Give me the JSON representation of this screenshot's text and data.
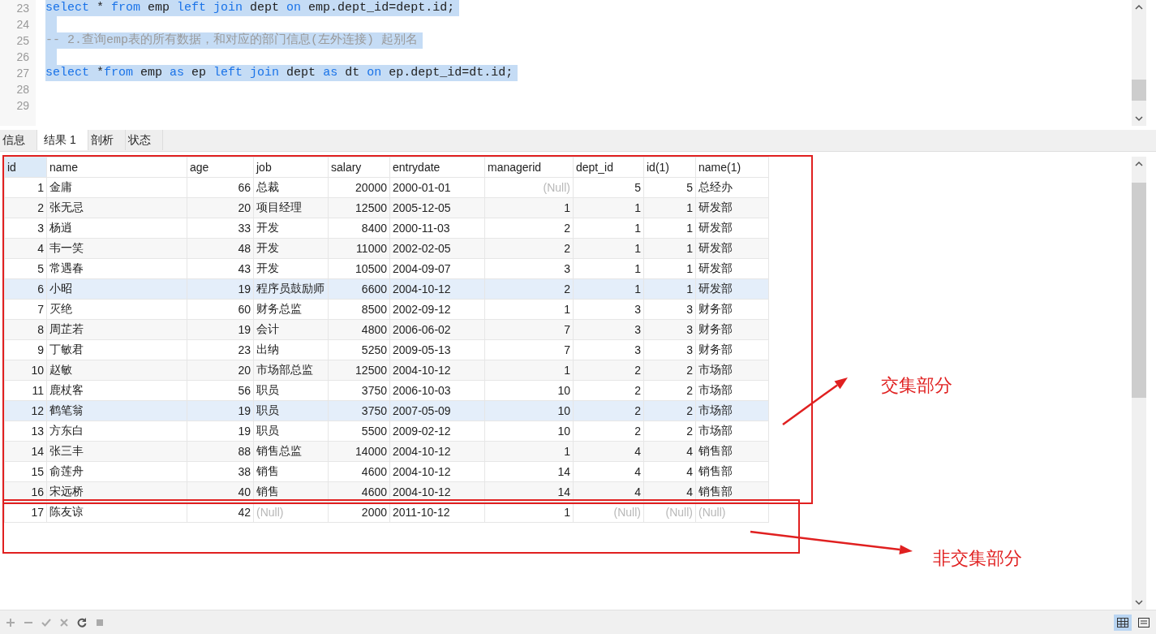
{
  "editor": {
    "lines": [
      {
        "number": "23",
        "selected": true,
        "tokens": [
          {
            "text": "select",
            "kind": "keyword"
          },
          {
            "text": " * ",
            "kind": "plain"
          },
          {
            "text": "from",
            "kind": "keyword"
          },
          {
            "text": " emp ",
            "kind": "plain"
          },
          {
            "text": "left join",
            "kind": "keyword"
          },
          {
            "text": " dept ",
            "kind": "plain"
          },
          {
            "text": "on",
            "kind": "keyword"
          },
          {
            "text": " emp.dept_id=dept.id;",
            "kind": "plain"
          }
        ]
      },
      {
        "number": "24",
        "selected": true
      },
      {
        "number": "25",
        "selected": true,
        "tokens": [
          {
            "text": "-- 2.查询emp表的所有数据，和对应的部门信息(左外连接) 起别名",
            "kind": "comment"
          }
        ]
      },
      {
        "number": "26",
        "selected": true
      },
      {
        "number": "27",
        "selected": true,
        "tokens": [
          {
            "text": "select",
            "kind": "keyword"
          },
          {
            "text": " *",
            "kind": "plain"
          },
          {
            "text": "from",
            "kind": "keyword"
          },
          {
            "text": " emp ",
            "kind": "plain"
          },
          {
            "text": "as",
            "kind": "keyword"
          },
          {
            "text": " ep ",
            "kind": "plain"
          },
          {
            "text": "left join",
            "kind": "keyword"
          },
          {
            "text": " dept ",
            "kind": "plain"
          },
          {
            "text": "as",
            "kind": "keyword"
          },
          {
            "text": " dt ",
            "kind": "plain"
          },
          {
            "text": "on",
            "kind": "keyword"
          },
          {
            "text": " ep.dept_id=dt.id;",
            "kind": "plain"
          }
        ]
      },
      {
        "number": "28",
        "selected": false
      },
      {
        "number": "29",
        "selected": false
      }
    ]
  },
  "tabs": [
    {
      "label": "信息",
      "selected": false
    },
    {
      "label": "结果 1",
      "selected": true
    },
    {
      "label": "剖析",
      "selected": false
    },
    {
      "label": "状态",
      "selected": false
    }
  ],
  "table": {
    "columns": [
      {
        "label": "id",
        "kind": "number"
      },
      {
        "label": "name",
        "kind": "text"
      },
      {
        "label": "age",
        "kind": "number"
      },
      {
        "label": "job",
        "kind": "text"
      },
      {
        "label": "salary",
        "kind": "number"
      },
      {
        "label": "entrydate",
        "kind": "text"
      },
      {
        "label": "managerid",
        "kind": "number"
      },
      {
        "label": "dept_id",
        "kind": "number"
      },
      {
        "label": "id(1)",
        "kind": "number"
      },
      {
        "label": "name(1)",
        "kind": "text"
      }
    ],
    "rows": [
      {
        "highlighted": false,
        "cells": [
          "1",
          "金庸",
          "66",
          "总裁",
          "20000",
          "2000-01-01",
          {
            "text": "(Null)",
            "null": true
          },
          "5",
          "5",
          "总经办"
        ]
      },
      {
        "highlighted": false,
        "cells": [
          "2",
          "张无忌",
          "20",
          "项目经理",
          "12500",
          "2005-12-05",
          "1",
          "1",
          "1",
          "研发部"
        ]
      },
      {
        "highlighted": false,
        "cells": [
          "3",
          "杨逍",
          "33",
          "开发",
          "8400",
          "2000-11-03",
          "2",
          "1",
          "1",
          "研发部"
        ]
      },
      {
        "highlighted": false,
        "cells": [
          "4",
          "韦一笑",
          "48",
          "开发",
          "11000",
          "2002-02-05",
          "2",
          "1",
          "1",
          "研发部"
        ]
      },
      {
        "highlighted": false,
        "cells": [
          "5",
          "常遇春",
          "43",
          "开发",
          "10500",
          "2004-09-07",
          "3",
          "1",
          "1",
          "研发部"
        ]
      },
      {
        "highlighted": true,
        "cells": [
          "6",
          "小昭",
          "19",
          "程序员鼓励师",
          "6600",
          "2004-10-12",
          "2",
          "1",
          "1",
          "研发部"
        ]
      },
      {
        "highlighted": false,
        "cells": [
          "7",
          "灭绝",
          "60",
          "财务总监",
          "8500",
          "2002-09-12",
          "1",
          "3",
          "3",
          "财务部"
        ]
      },
      {
        "highlighted": false,
        "cells": [
          "8",
          "周芷若",
          "19",
          "会计",
          "4800",
          "2006-06-02",
          "7",
          "3",
          "3",
          "财务部"
        ]
      },
      {
        "highlighted": false,
        "cells": [
          "9",
          "丁敏君",
          "23",
          "出纳",
          "5250",
          "2009-05-13",
          "7",
          "3",
          "3",
          "财务部"
        ]
      },
      {
        "highlighted": false,
        "cells": [
          "10",
          "赵敏",
          "20",
          "市场部总监",
          "12500",
          "2004-10-12",
          "1",
          "2",
          "2",
          "市场部"
        ]
      },
      {
        "highlighted": false,
        "cells": [
          "11",
          "鹿杖客",
          "56",
          "职员",
          "3750",
          "2006-10-03",
          "10",
          "2",
          "2",
          "市场部"
        ]
      },
      {
        "highlighted": true,
        "cells": [
          "12",
          "鹤笔翁",
          "19",
          "职员",
          "3750",
          "2007-05-09",
          "10",
          "2",
          "2",
          "市场部"
        ]
      },
      {
        "highlighted": false,
        "cells": [
          "13",
          "方东白",
          "19",
          "职员",
          "5500",
          "2009-02-12",
          "10",
          "2",
          "2",
          "市场部"
        ]
      },
      {
        "highlighted": false,
        "cells": [
          "14",
          "张三丰",
          "88",
          "销售总监",
          "14000",
          "2004-10-12",
          "1",
          "4",
          "4",
          "销售部"
        ]
      },
      {
        "highlighted": false,
        "cells": [
          "15",
          "俞莲舟",
          "38",
          "销售",
          "4600",
          "2004-10-12",
          "14",
          "4",
          "4",
          "销售部"
        ]
      },
      {
        "highlighted": false,
        "cells": [
          "16",
          "宋远桥",
          "40",
          "销售",
          "4600",
          "2004-10-12",
          "14",
          "4",
          "4",
          "销售部"
        ]
      },
      {
        "highlighted": false,
        "cells": [
          "17",
          "陈友谅",
          "42",
          {
            "text": "(Null)",
            "null": true
          },
          "2000",
          "2011-10-12",
          "1",
          {
            "text": "(Null)",
            "null": true
          },
          {
            "text": "(Null)",
            "null": true
          },
          {
            "text": "(Null)",
            "null": true
          }
        ]
      }
    ]
  },
  "annotations": [
    {
      "label": "交集部分"
    },
    {
      "label": "非交集部分"
    }
  ],
  "toolbar": [
    {
      "kind": "add"
    },
    {
      "kind": "remove"
    },
    {
      "kind": "apply"
    },
    {
      "kind": "cancel"
    },
    {
      "kind": "refresh"
    },
    {
      "kind": "stop"
    }
  ],
  "view_buttons": [
    {
      "kind": "grid",
      "selected": true
    },
    {
      "kind": "form",
      "selected": false
    }
  ]
}
